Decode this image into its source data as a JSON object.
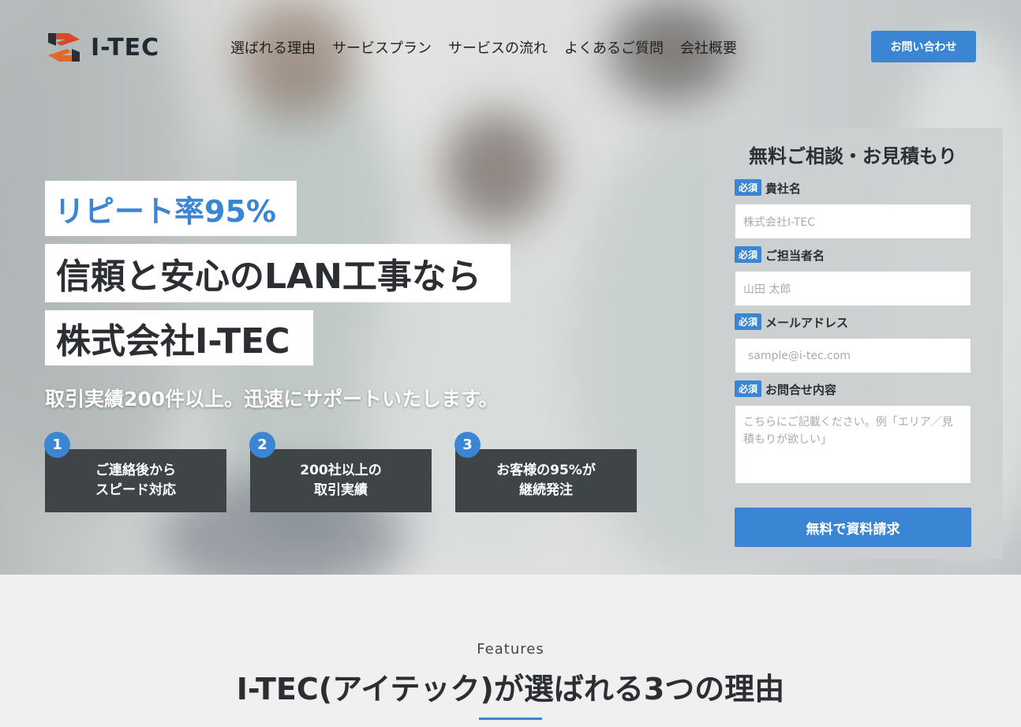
{
  "brand": {
    "name": "I-TEC",
    "accent_color": "#3a86d4",
    "dark_color": "#3f4447"
  },
  "nav": {
    "items": [
      "選ばれる理由",
      "サービスプラン",
      "サービスの流れ",
      "よくあるご質問",
      "会社概要"
    ],
    "contact_label": "お問い合わせ"
  },
  "hero": {
    "tagline": "リピート率95%",
    "headline_1": "信頼と安心のLAN工事なら",
    "headline_2": "株式会社I-TEC",
    "subline": "取引実績200件以上。迅速にサポートいたします。",
    "features": [
      {
        "num": "1",
        "line1": "ご連絡後から",
        "line2": "スピード対応"
      },
      {
        "num": "2",
        "line1": "200社以上の",
        "line2": "取引実績"
      },
      {
        "num": "3",
        "line1": "お客様の95%が",
        "line2": "継続発注"
      }
    ]
  },
  "form": {
    "title": "無料ご相談・お見積もり",
    "required_badge": "必須",
    "fields": [
      {
        "label": "貴社名",
        "placeholder": "株式会社I-TEC"
      },
      {
        "label": "ご担当者名",
        "placeholder": "山田 太郎"
      },
      {
        "label": "メールアドレス",
        "placeholder": "sample@i-tec.com"
      },
      {
        "label": "お問合せ内容",
        "placeholder": "こちらにご記載ください。例「エリア／見積もりが欲しい」"
      }
    ],
    "submit_label": "無料で資料請求"
  },
  "features_section": {
    "eyebrow": "Features",
    "title": "I-TEC(アイテック)が選ばれる3つの理由"
  }
}
